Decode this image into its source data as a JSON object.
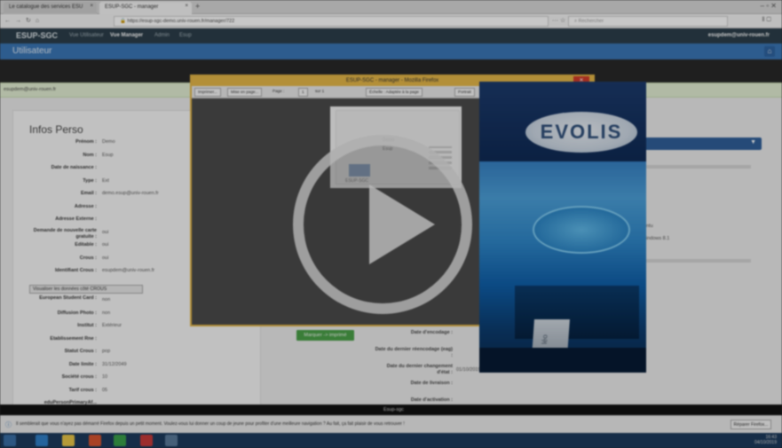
{
  "browser": {
    "tabs": [
      {
        "label": "Le catalogue des services ESU"
      },
      {
        "label": "ESUP-SGC - manager"
      }
    ],
    "url": "https://esup-sgc-demo.univ-rouen.fr/manager/722",
    "search_placeholder": "Rechercher"
  },
  "app": {
    "brand": "ESUP-SGC",
    "menu": [
      {
        "label": "Vue Utilisateur",
        "active": false
      },
      {
        "label": "Vue Manager",
        "active": true
      },
      {
        "label": "Admin",
        "active": false
      },
      {
        "label": "Esup",
        "active": false
      }
    ],
    "user_email": "esupdem@univ-rouen.fr",
    "page_title": "Utilisateur",
    "alert": "esupdem@univ-rouen.fr"
  },
  "info": {
    "title": "Infos Perso",
    "fields": [
      {
        "label": "Prénom :",
        "value": "Demo"
      },
      {
        "label": "Nom :",
        "value": "Esup"
      },
      {
        "label": "Date de naissance :",
        "value": ""
      },
      {
        "label": "Type :",
        "value": "Ext"
      },
      {
        "label": "Email :",
        "value": "demo.esup@univ-rouen.fr"
      },
      {
        "label": "Adresse :",
        "value": ""
      },
      {
        "label": "Adresse Externe :",
        "value": ""
      },
      {
        "label": "Demande de nouvelle carte gratuite :",
        "value": "oui"
      },
      {
        "label": "Editable :",
        "value": "oui"
      },
      {
        "label": "Crous :",
        "value": "oui"
      },
      {
        "label": "Identifiant Crous :",
        "value": "esupdem@univ-rouen.fr"
      }
    ],
    "crous_button": "Visualiser les données côté CROUS",
    "fields2": [
      {
        "label": "European Student Card :",
        "value": "non"
      },
      {
        "label": "Diffusion Photo :",
        "value": "non"
      },
      {
        "label": "Institut :",
        "value": "Extérieur"
      },
      {
        "label": "Etablissement Rne :",
        "value": ""
      },
      {
        "label": "Statut Crous :",
        "value": "pop"
      },
      {
        "label": "Date limite :",
        "value": "31/12/2049"
      },
      {
        "label": "Société crous :",
        "value": "10"
      },
      {
        "label": "Tarif crous :",
        "value": "05"
      },
      {
        "label": "eduPersonPrimaryAf...",
        "value": ""
      }
    ]
  },
  "right": {
    "line1": "ntu",
    "line2": "indows 8.1",
    "green_button": "Marquer -> imprimé",
    "fields": [
      {
        "label": "Date d'encodage :",
        "value": ""
      },
      {
        "label": "Date du dernier réencodage (eag) :",
        "value": ""
      },
      {
        "label": "Date du dernier changement d'état :",
        "value": "01/10/2019"
      },
      {
        "label": "Date de livraison :",
        "value": ""
      },
      {
        "label": "Date d'activation :",
        "value": ""
      }
    ],
    "footer": "Esup-sgc"
  },
  "popup": {
    "title": "ESUP-SGC - manager - Mozilla Firefox",
    "toolbar": [
      "Imprimer...",
      "Mise en page...",
      "Page : ",
      "1",
      "sur 1",
      "Échelle : Adaptée à la page",
      "Portrait"
    ],
    "preview_lines": [
      "Demo",
      "Esup"
    ],
    "preview_label": "ESUP-SGC"
  },
  "video": {
    "logo_text": "EVOLIS",
    "card_label": "léo"
  },
  "notification": {
    "text": "Il semblerait que vous n'ayez pas démarré Firefox depuis un petit moment. Voulez-vous lui donner un coup de jeune pour profiter d'une meilleure navigation ? Au fait, ça fait plaisir de vous retrouver !",
    "button": "Réparer Firefox..."
  },
  "taskbar": {
    "time": "16:43",
    "date": "04/10/2019"
  },
  "colors": {
    "app_header": "#2c3e4a",
    "subbar": "#3a76b6",
    "popup_border": "#e3b545",
    "green": "#4aa048"
  },
  "icons": [
    "back-icon",
    "forward-icon",
    "reload-icon",
    "home-icon",
    "lock-icon",
    "bookmark-star-icon",
    "close-icon",
    "play-icon"
  ]
}
